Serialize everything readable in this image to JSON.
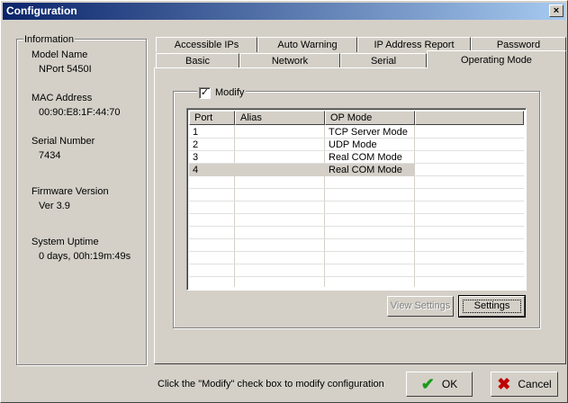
{
  "window": {
    "title": "Configuration",
    "close_label": "×"
  },
  "info": {
    "legend": "Information",
    "items": [
      {
        "label": "Model Name",
        "value": "NPort 5450I"
      },
      {
        "label": "MAC Address",
        "value": "00:90:E8:1F:44:70"
      },
      {
        "label": "Serial Number",
        "value": "7434"
      },
      {
        "label": "Firmware Version",
        "value": "Ver 3.9"
      },
      {
        "label": "System Uptime",
        "value": "0 days, 00h:19m:49s"
      }
    ]
  },
  "tabs": {
    "back_row": [
      "Accessible IPs",
      "Auto Warning",
      "IP Address Report",
      "Password"
    ],
    "front_row": [
      "Basic",
      "Network",
      "Serial",
      "Operating Mode"
    ],
    "active": "Operating Mode"
  },
  "modify": {
    "label": "Modify",
    "checked": "✓"
  },
  "table": {
    "columns": [
      "Port",
      "Alias",
      "OP Mode"
    ],
    "rows": [
      {
        "port": "1",
        "alias": "",
        "mode": "TCP Server Mode"
      },
      {
        "port": "2",
        "alias": "",
        "mode": "UDP Mode"
      },
      {
        "port": "3",
        "alias": "",
        "mode": "Real COM Mode"
      },
      {
        "port": "4",
        "alias": "",
        "mode": "Real COM Mode"
      }
    ],
    "selected_port": "4"
  },
  "buttons": {
    "view_settings": "View Settings",
    "settings": "Settings",
    "ok": "OK",
    "cancel": "Cancel"
  },
  "status": "Click the \"Modify\" check box to modify configuration",
  "colors": {
    "ok_icon": "#1a9a1a",
    "cancel_icon": "#c00000"
  }
}
